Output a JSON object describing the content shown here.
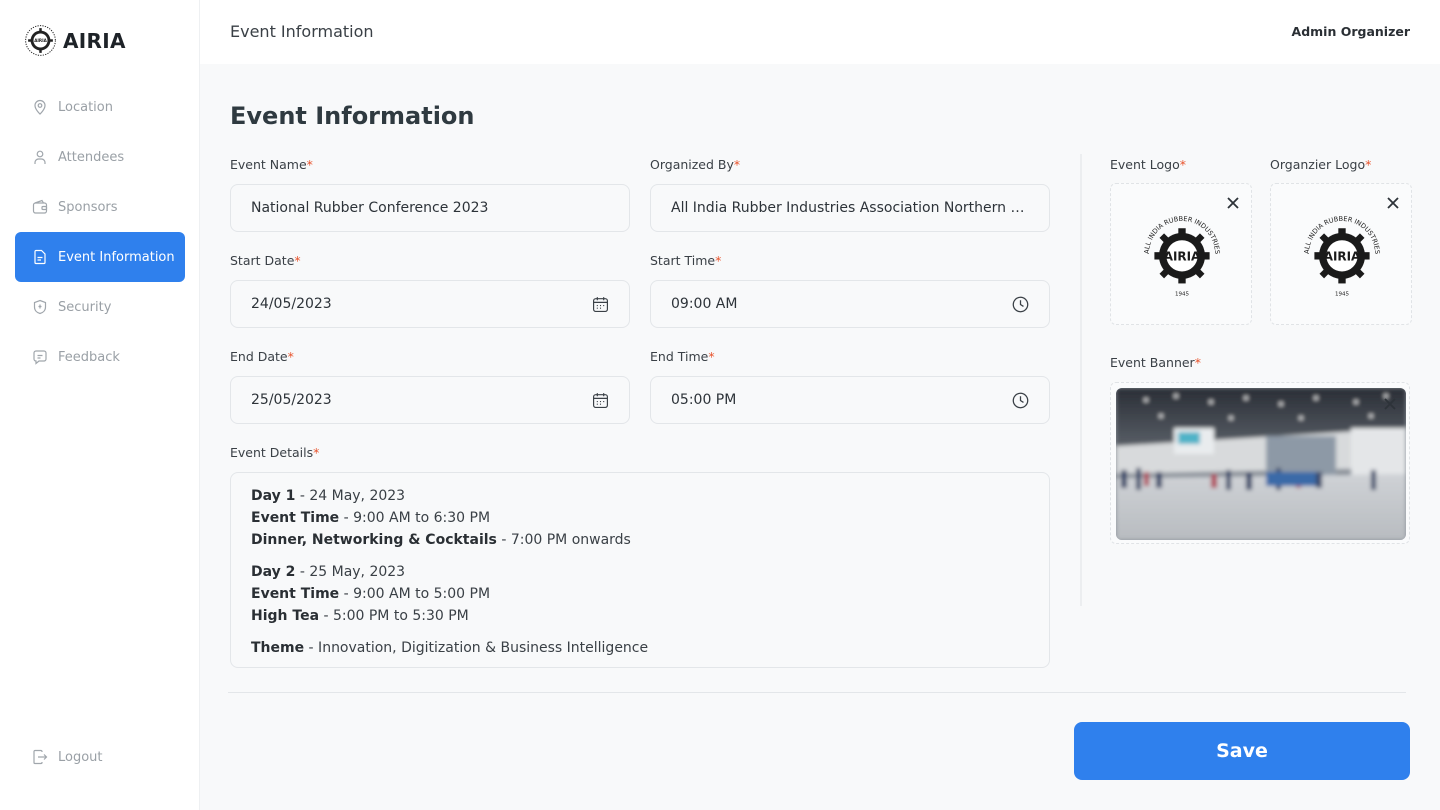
{
  "brand": {
    "name": "AIRIA",
    "mark_text": "AIRIA"
  },
  "sidebar": {
    "items": [
      {
        "label": "Location",
        "icon": "location-pin-icon"
      },
      {
        "label": "Attendees",
        "icon": "user-icon"
      },
      {
        "label": "Sponsors",
        "icon": "wallet-icon"
      },
      {
        "label": "Event Information",
        "icon": "document-icon",
        "active": true
      },
      {
        "label": "Security",
        "icon": "shield-icon"
      },
      {
        "label": "Feedback",
        "icon": "chat-icon"
      }
    ],
    "logout": "Logout"
  },
  "topbar": {
    "title": "Event Information",
    "user": "Admin Organizer"
  },
  "main": {
    "title": "Event Information",
    "required_mark": "*",
    "fields": {
      "event_name": {
        "label": "Event Name",
        "value": "National Rubber Conference 2023"
      },
      "organized_by": {
        "label": "Organized By",
        "value": "All India Rubber Industries Association Northern Region"
      },
      "start_date": {
        "label": "Start Date",
        "value": "24/05/2023"
      },
      "start_time": {
        "label": "Start Time",
        "value": "09:00 AM"
      },
      "end_date": {
        "label": "End Date",
        "value": "25/05/2023"
      },
      "end_time": {
        "label": "End Time",
        "value": "05:00 PM"
      }
    },
    "details": {
      "label": "Event Details",
      "day1": {
        "title": "Day 1",
        "date": "- 24 May, 2023",
        "time_label": "Event Time",
        "time": " - 9:00 AM to 6:30 PM",
        "dinner_label": "Dinner, Networking & Cocktails",
        "dinner": " - 7:00 PM onwards"
      },
      "day2": {
        "title": "Day 2",
        "date": "- 25 May, 2023",
        "time_label": "Event Time",
        "time": " - 9:00 AM to 5:00 PM",
        "tea_label": "High Tea",
        "tea": " - 5:00 PM to 5:30 PM"
      },
      "theme_label": "Theme",
      "theme": " - Innovation, Digitization & Business Intelligence"
    },
    "media": {
      "event_logo_label": "Event Logo",
      "organizer_logo_label": "Organzier Logo",
      "event_banner_label": "Event Banner",
      "seal": {
        "ring_text": "ALL INDIA RUBBER INDUSTRIES ASSOCIATION",
        "center": "AIRIA",
        "year": "1945"
      }
    },
    "save_label": "Save"
  },
  "colors": {
    "accent": "#2f80ed",
    "required": "#e8532c"
  }
}
